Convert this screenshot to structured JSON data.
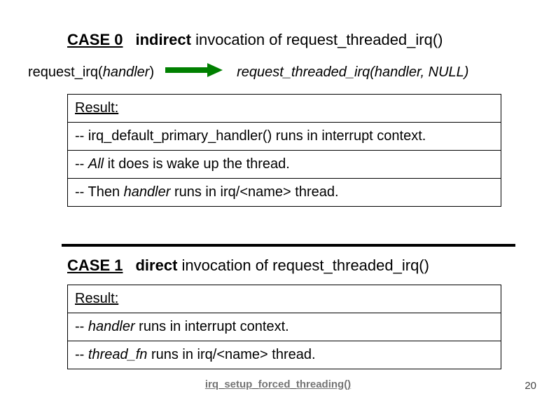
{
  "case0": {
    "label": "CASE 0",
    "desc_bold": "indirect",
    "desc_rest": " invocation of request_threaded_irq()",
    "call_left_pre": "request_irq(",
    "call_left_ital": "handler",
    "call_left_post": ")",
    "call_right_pre": "request_threaded_irq(",
    "call_right_ital": "handler",
    "call_right_post": ", NULL)",
    "result_title": "Result:",
    "line1": "-- irq_default_primary_handler() runs in interrupt context.",
    "line2_pre": "-- ",
    "line2_ital": "All",
    "line2_post": " it does is wake up the thread.",
    "line3_pre": "-- Then ",
    "line3_ital": "handler",
    "line3_post": " runs in irq/<name> thread."
  },
  "case1": {
    "label": "CASE 1",
    "desc_bold": "direct",
    "desc_rest": " invocation of request_threaded_irq()",
    "result_title": "Result:",
    "line1_pre": "-- ",
    "line1_ital": "handler",
    "line1_post": " runs in interrupt context.",
    "line2_pre": "-- ",
    "line2_ital": "thread_fn",
    "line2_post": " runs in irq/<name> thread."
  },
  "footer_link": "irq_setup_forced_threading()",
  "page_number": "20",
  "arrow_color": "#008000"
}
